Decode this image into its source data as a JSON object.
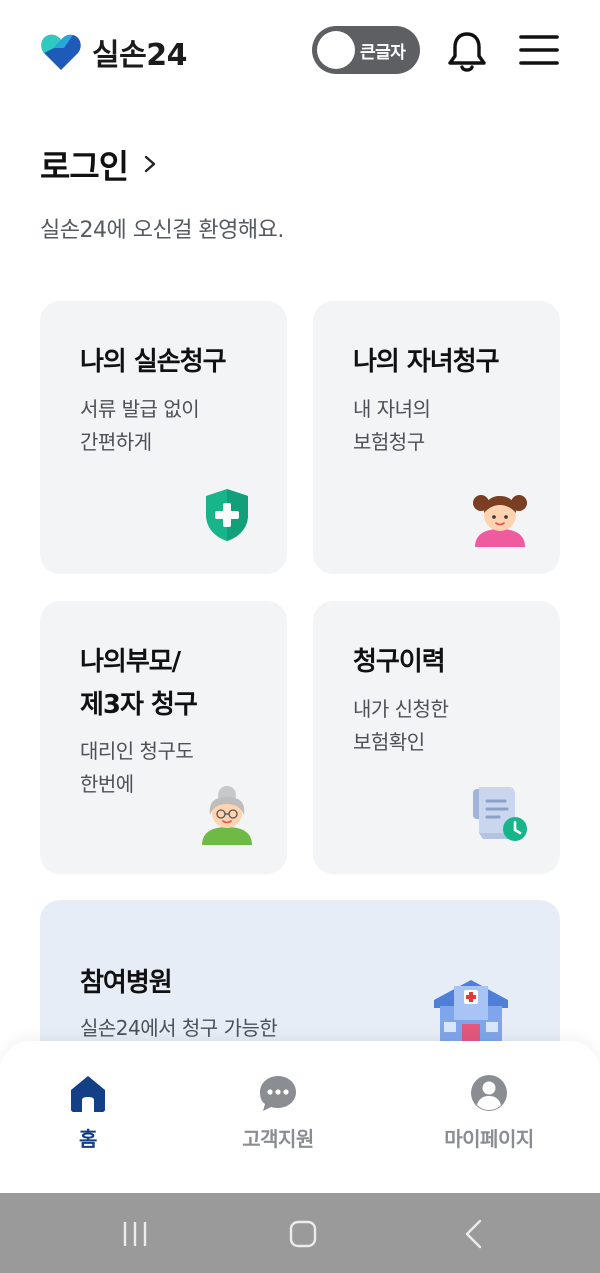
{
  "header": {
    "app_name": "실손24",
    "font_toggle_label": "큰글자",
    "font_toggle_on": false,
    "logo_icon": "heart-logo-icon",
    "notification_icon": "bell-icon",
    "menu_icon": "hamburger-menu-icon"
  },
  "login": {
    "title": "로그인",
    "welcome": "실손24에 오신걸 환영해요."
  },
  "cards": [
    {
      "title": "나의 실손청구",
      "desc_line1": "서류 발급 없이",
      "desc_line2": "간편하게",
      "icon": "shield-plus-icon"
    },
    {
      "title": "나의 자녀청구",
      "desc_line1": "내 자녀의",
      "desc_line2": "보험청구",
      "icon": "child-avatar-icon"
    },
    {
      "title_line1": "나의부모/",
      "title_line2": "제3자 청구",
      "desc_line1": "대리인 청구도",
      "desc_line2": "한번에",
      "icon": "grandparent-avatar-icon"
    },
    {
      "title": "청구이력",
      "desc_line1": "내가 신청한",
      "desc_line2": "보험확인",
      "icon": "document-clock-icon"
    }
  ],
  "hospital_card": {
    "title": "참여병원",
    "desc": "실손24에서 청구 가능한",
    "icon": "hospital-icon"
  },
  "bottom_nav": [
    {
      "label": "홈",
      "icon": "home-icon",
      "active": true
    },
    {
      "label": "고객지원",
      "icon": "chat-bubble-icon",
      "active": false
    },
    {
      "label": "마이페이지",
      "icon": "user-circle-icon",
      "active": false
    }
  ],
  "colors": {
    "accent_navy": "#123f86",
    "shield_green": "#18b48a",
    "card_bg": "#f3f4f6",
    "hospital_card_bg": "#e6edf7",
    "toggle_bg": "#5d5f63"
  }
}
